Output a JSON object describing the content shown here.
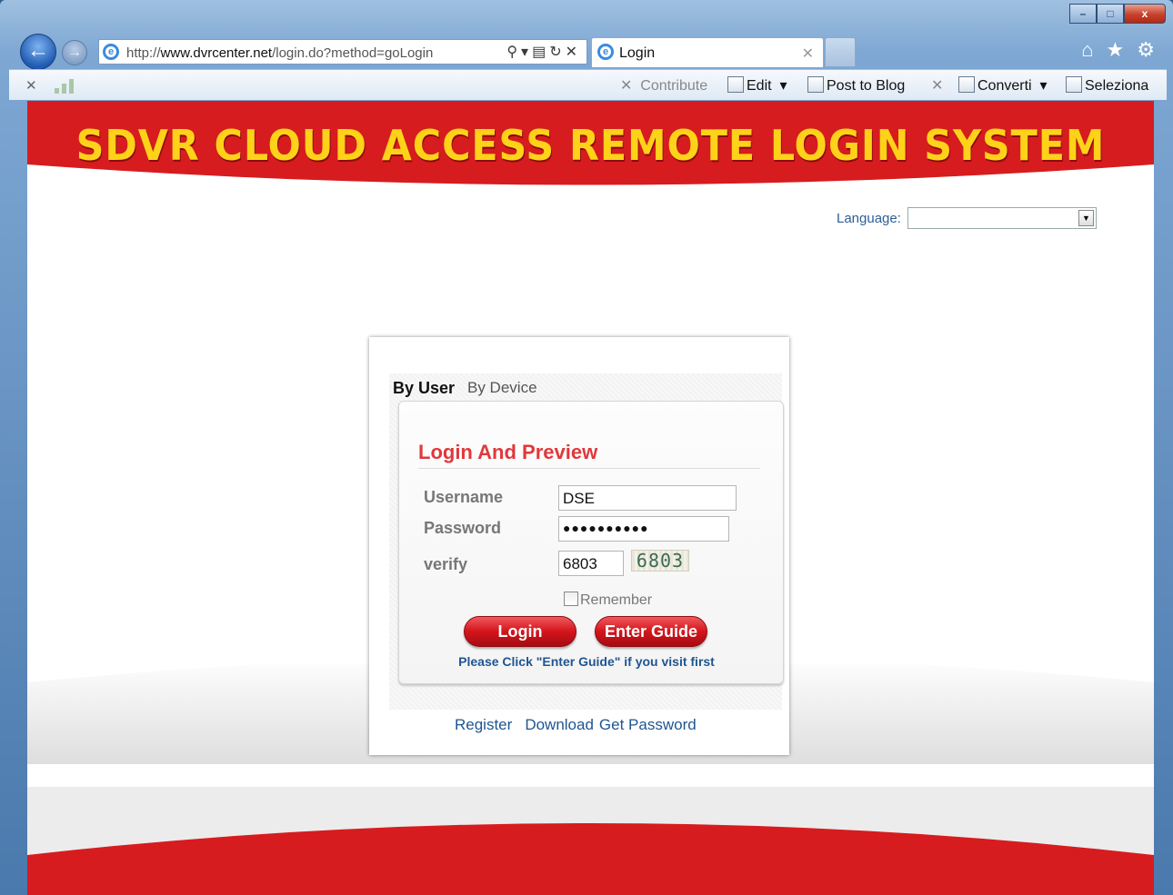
{
  "browser": {
    "address_host": "www.dvrcenter.net",
    "address_prefix": "http://",
    "address_path": "/login.do?method=goLogin",
    "tab_title": "Login",
    "window_controls": {
      "minimize": "–",
      "maximize": "□",
      "close": "x"
    },
    "command_bar": {
      "contribute": "Contribute",
      "edit": "Edit",
      "post_to_blog": "Post to Blog",
      "converti": "Converti",
      "seleziona": "Seleziona"
    },
    "icons": [
      "back-icon",
      "forward-icon",
      "ie-icon",
      "search-icon",
      "refresh-icon",
      "stop-icon",
      "home-icon",
      "favorites-icon",
      "settings-icon"
    ]
  },
  "page": {
    "banner_title": "SDVR CLOUD ACCESS REMOTE LOGIN SYSTEM",
    "language_label": "Language:",
    "language_value": "",
    "tabs": {
      "by_user": "By User",
      "by_device": "By Device"
    },
    "form": {
      "title": "Login And Preview",
      "username_label": "Username",
      "username_value": "DSE",
      "password_label": "Password",
      "password_value": "●●●●●●●●●●",
      "verify_label": "verify",
      "verify_value": "6803",
      "captcha_text": "6803",
      "remember_label": "Remember",
      "login_button": "Login",
      "guide_button": "Enter Guide",
      "hint": "Please Click \"Enter Guide\" if you visit first"
    },
    "links": {
      "register": "Register",
      "download": "Download",
      "get_password": "Get Password"
    },
    "colors": {
      "banner_red": "#d61c1f",
      "title_yellow": "#ffd21a",
      "form_title": "#e0383c",
      "link_blue": "#1f5592"
    }
  }
}
